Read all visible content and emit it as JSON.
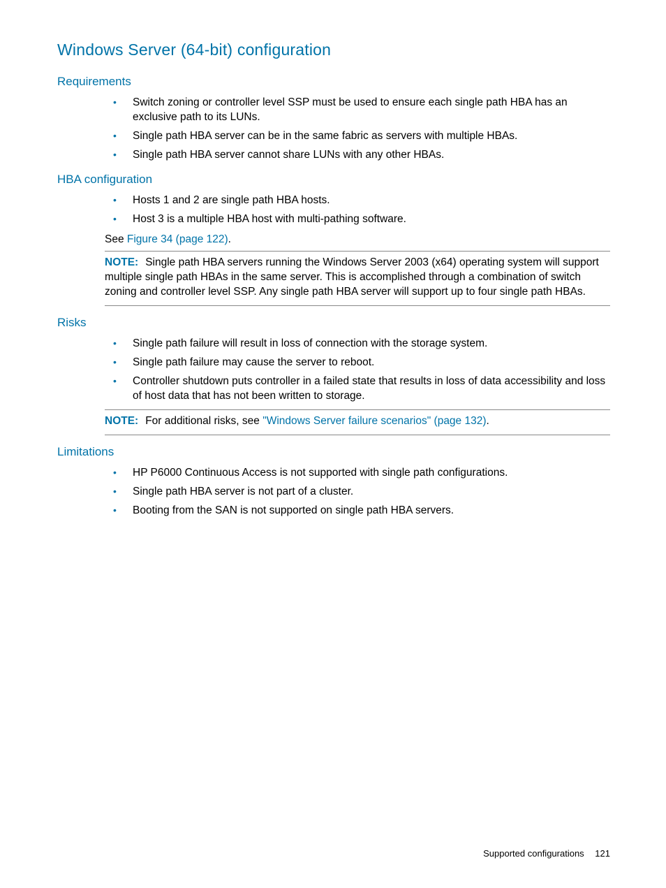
{
  "title": "Windows Server (64-bit) configuration",
  "sections": {
    "requirements": {
      "heading": "Requirements",
      "items": [
        "Switch zoning or controller level SSP must be used to ensure each single path HBA has an exclusive path to its LUNs.",
        "Single path HBA server can be in the same fabric as servers with multiple HBAs.",
        "Single path HBA server cannot share LUNs with any other HBAs."
      ]
    },
    "hba": {
      "heading": "HBA configuration",
      "items": [
        "Hosts 1 and 2 are single path HBA hosts.",
        "Host 3 is a multiple HBA host with multi-pathing software."
      ],
      "see_prefix": "See ",
      "see_link": "Figure 34 (page 122)",
      "see_suffix": ".",
      "note_label": "NOTE:",
      "note_text": "Single path HBA servers running the Windows Server 2003 (x64) operating system will support multiple single path HBAs in the same server. This is accomplished through a combination of switch zoning and controller level SSP. Any single path HBA server will support up to four single path HBAs."
    },
    "risks": {
      "heading": "Risks",
      "items": [
        "Single path failure will result in loss of connection with the storage system.",
        "Single path failure may cause the server to reboot.",
        "Controller shutdown puts controller in a failed state that results in loss of data accessibility and loss of host data that has not been written to storage."
      ],
      "note_label": "NOTE:",
      "note_prefix": "For additional risks, see ",
      "note_link": "\"Windows Server failure scenarios\" (page 132)",
      "note_suffix": "."
    },
    "limitations": {
      "heading": "Limitations",
      "items": [
        "HP P6000 Continuous Access is not supported with single path configurations.",
        "Single path HBA server is not part of a cluster.",
        "Booting from the SAN is not supported on single path HBA servers."
      ]
    }
  },
  "footer": {
    "section": "Supported configurations",
    "page": "121"
  }
}
